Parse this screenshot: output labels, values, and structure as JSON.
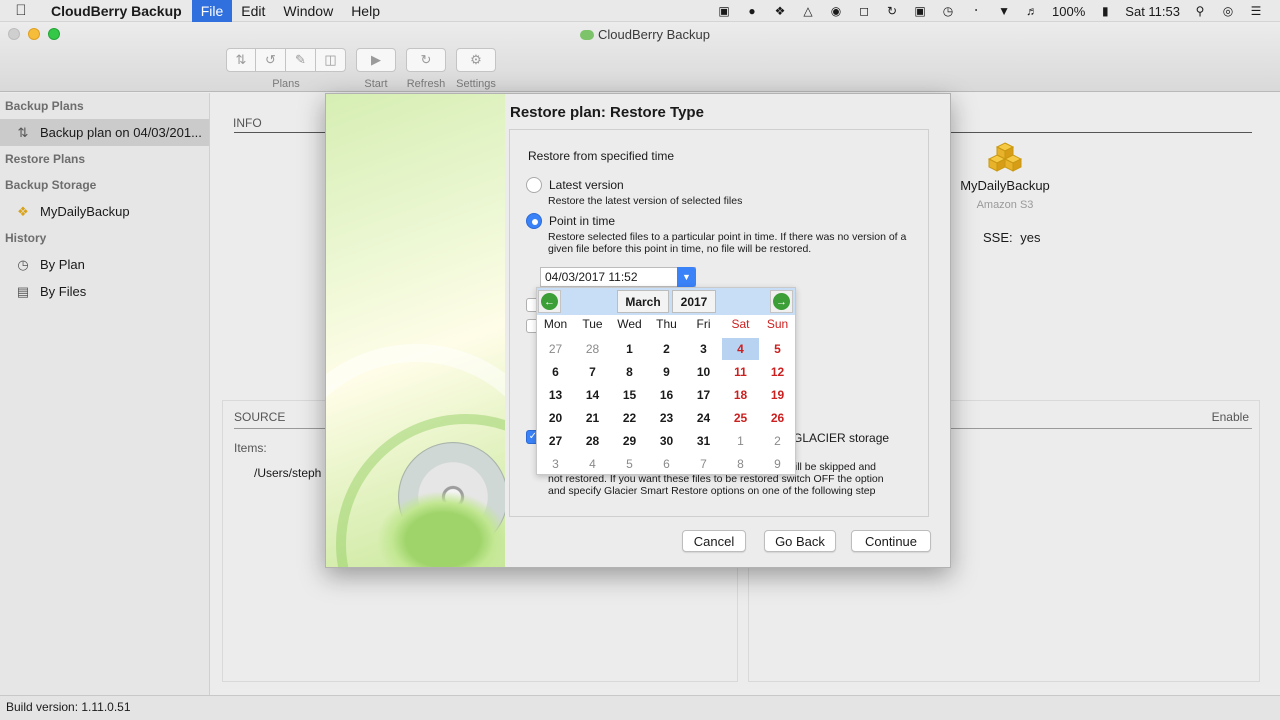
{
  "menubar": {
    "app_name": "CloudBerry Backup",
    "menus": [
      "File",
      "Edit",
      "Window",
      "Help"
    ],
    "battery": "100%",
    "clock": "Sat 11:53"
  },
  "window": {
    "title": "CloudBerry Backup"
  },
  "toolbar": {
    "plans_label": "Plans",
    "start_label": "Start",
    "refresh_label": "Refresh",
    "settings_label": "Settings"
  },
  "sidebar": {
    "backup_plans_header": "Backup Plans",
    "backup_plan_item": "Backup plan on 04/03/201...",
    "restore_plans_header": "Restore Plans",
    "backup_storage_header": "Backup Storage",
    "storage_item": "MyDailyBackup",
    "history_header": "History",
    "history_by_plan": "By Plan",
    "history_by_files": "By Files"
  },
  "info": {
    "title": "INFO",
    "dest_name": "MyDailyBackup",
    "dest_type": "Amazon S3",
    "sse_label": "SSE:",
    "sse_value": "yes"
  },
  "source": {
    "title": "SOURCE",
    "items_label": "Items:",
    "item_path": "/Users/steph",
    "enable_label": "Enable"
  },
  "dialog": {
    "title": "Restore plan: Restore Type",
    "section_label": "Restore from specified time",
    "latest_label": "Latest version",
    "latest_desc": "Restore the latest version of selected files",
    "pit_label": "Point in time",
    "pit_desc": "Restore selected files to a particular point in time. If there was no version of a given file before this point in time, no file will be restored.",
    "datetime_value": "04/03/2017 11:52",
    "glacier_label": "GLACIER storage",
    "glacier_note_visible": "s will be skipped and",
    "glacier_note_line2": "not restored. If you want these files to be restored switch OFF the option",
    "glacier_note_line3": "and specify Glacier Smart Restore options on one of the following step",
    "cancel_label": "Cancel",
    "goback_label": "Go Back",
    "continue_label": "Continue"
  },
  "calendar": {
    "month": "March",
    "year": "2017",
    "weekdays": [
      "Mon",
      "Tue",
      "Wed",
      "Thu",
      "Fri",
      "Sat",
      "Sun"
    ],
    "weeks": [
      [
        "27",
        "28",
        "1",
        "2",
        "3",
        "4",
        "5"
      ],
      [
        "6",
        "7",
        "8",
        "9",
        "10",
        "11",
        "12"
      ],
      [
        "13",
        "14",
        "15",
        "16",
        "17",
        "18",
        "19"
      ],
      [
        "20",
        "21",
        "22",
        "23",
        "24",
        "25",
        "26"
      ],
      [
        "27",
        "28",
        "29",
        "30",
        "31",
        "1",
        "2"
      ],
      [
        "3",
        "4",
        "5",
        "6",
        "7",
        "8",
        "9"
      ]
    ],
    "selected_day": "4"
  },
  "statusbar": {
    "build": "Build version: 1.11.0.51"
  },
  "colors": {
    "accent": "#3a82f7",
    "weekend": "#cc1f1f",
    "calendar_header": "#c8def7",
    "nav_green": "#3c9e36"
  }
}
